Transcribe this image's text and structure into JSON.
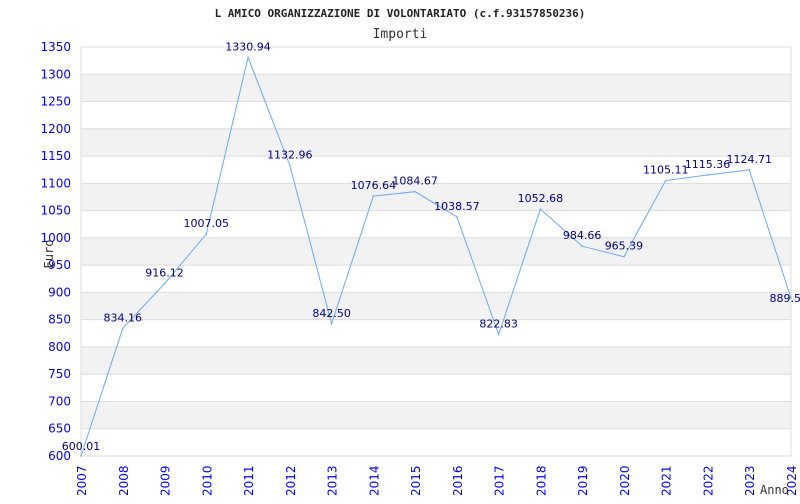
{
  "chart_data": {
    "type": "line",
    "title": "L AMICO ORGANIZZAZIONE DI VOLONTARIATO (c.f.93157850236)",
    "subtitle": "Importi",
    "xlabel": "Anno",
    "ylabel": "Euro",
    "ylim": [
      600,
      1350
    ],
    "yticks": [
      600,
      650,
      700,
      750,
      800,
      850,
      900,
      950,
      1000,
      1050,
      1100,
      1150,
      1200,
      1250,
      1300,
      1350
    ],
    "grid": true,
    "categories": [
      "2007",
      "2008",
      "2009",
      "2010",
      "2011",
      "2012",
      "2013",
      "2014",
      "2015",
      "2016",
      "2017",
      "2018",
      "2019",
      "2020",
      "2021",
      "2022",
      "2023",
      "2024"
    ],
    "values": [
      600.01,
      834.16,
      916.12,
      1007.05,
      1330.94,
      1132.96,
      842.5,
      1076.64,
      1084.67,
      1038.57,
      822.83,
      1052.68,
      984.66,
      965.39,
      1105.11,
      1115.36,
      1124.71,
      889.5
    ],
    "labels": [
      "600.01",
      "834.16",
      "916.12",
      "1007.05",
      "1330.94",
      "1132.96",
      "842.50",
      "1076.64",
      "1084.67",
      "1038.57",
      "822.83",
      "1052.68",
      "984.66",
      "965.39",
      "1105.11",
      "1115.36",
      "1124.71",
      "889.5"
    ],
    "colors": {
      "line": "#6aaaf0",
      "tick": "#0000ff",
      "label": "#000080",
      "band": "#f2f2f2"
    }
  }
}
